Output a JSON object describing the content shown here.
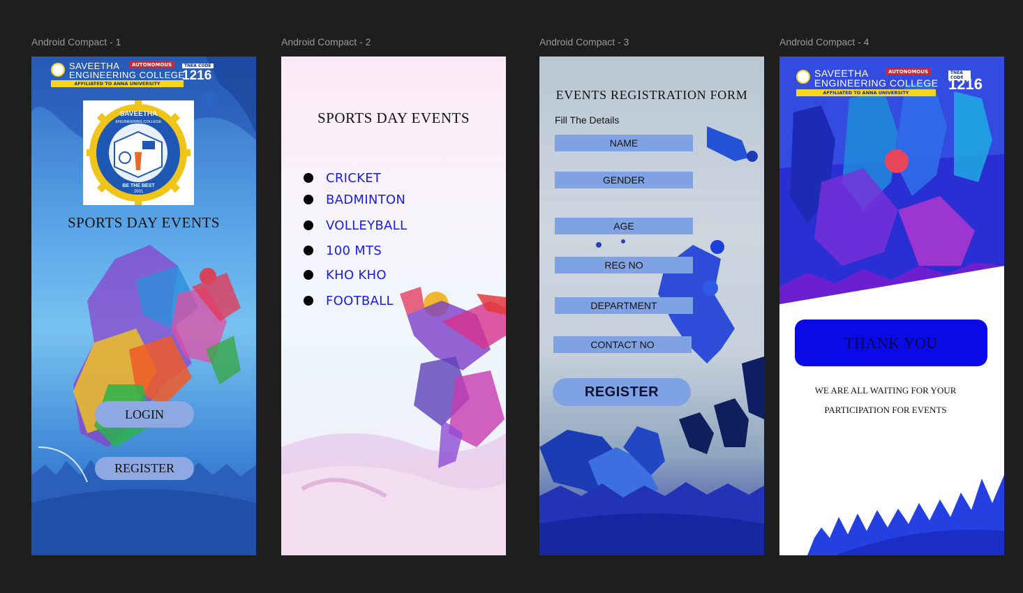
{
  "frames": [
    {
      "label": "Android Compact - 1"
    },
    {
      "label": "Android Compact - 2"
    },
    {
      "label": "Android Compact - 3"
    },
    {
      "label": "Android Compact - 4"
    }
  ],
  "college": {
    "name_line1": "SAVEETHA",
    "name_line2": "ENGINEERING COLLEGE",
    "autonomous": "AUTONOMOUS",
    "affiliation": "AFFILIATED TO ANNA UNIVERSITY",
    "tnea_label": "TNEA CODE",
    "tnea_code": "1216",
    "seal_top": "SAVEETHA",
    "seal_sub": "ENGINEERING COLLEGE",
    "seal_motto": "BE THE BEST",
    "seal_year": "2001"
  },
  "screen1": {
    "title": "SPORTS DAY EVENTS",
    "login_label": "LOGIN",
    "register_label": "REGISTER"
  },
  "screen2": {
    "title": "SPORTS DAY EVENTS",
    "events": [
      "CRICKET",
      "BADMINTON",
      "VOLLEYBALL",
      "100 MTS",
      "KHO KHO",
      "FOOTBALL"
    ]
  },
  "screen3": {
    "title": "EVENTS REGISTRATION FORM",
    "subtitle": "Fill The Details",
    "fields": [
      "NAME",
      "GENDER",
      "AGE",
      "REG NO",
      "DEPARTMENT",
      "CONTACT NO"
    ],
    "register_label": "REGISTER"
  },
  "screen4": {
    "thank_you": "THANK YOU",
    "message_line1": "WE ARE ALL WAITING FOR YOUR",
    "message_line2": "PARTICIPATION FOR EVENTS"
  },
  "colors": {
    "canvas_bg": "#1e1e1e",
    "pill_button": "#8ea8e2",
    "form_field": "#7fa2e4",
    "event_text": "#1a1af0",
    "thank_you_button": "#0a0ae8"
  }
}
